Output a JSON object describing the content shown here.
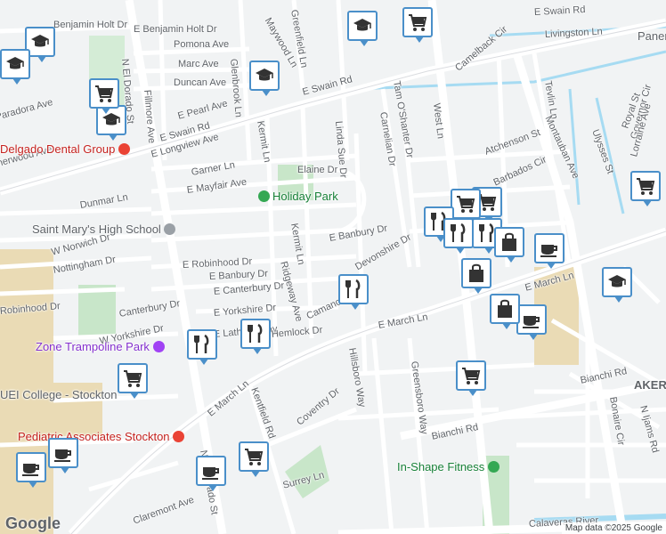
{
  "map": {
    "attribution": "Map data ©2025 Google",
    "logo": "Google",
    "colors": {
      "background": "#f1f3f4",
      "road": "#ffffff",
      "park": "#c8e6c9",
      "campus": "#eadbb5",
      "water": "#a6dbf2",
      "pin_border": "#4a8fc9",
      "pin_icon": "#333333"
    },
    "street_labels": [
      "E Swain Rd",
      "Benjamin Holt Dr",
      "E Benjamin Holt Dr",
      "Pomona Ave",
      "Marc Ave",
      "Duncan Ave",
      "Maywood Ln",
      "Greenfield Ln",
      "Glenbrook Ln",
      "E Swain Rd",
      "E Pearl Ave",
      "E Swain Rd",
      "E Longview Ave",
      "Garner Ln",
      "E Mayfair Ave",
      "Elaine Dr",
      "Linda Sue Dr",
      "Kermit Ln",
      "Fillmore Ave",
      "N El Dorado St",
      "Dunmar Ln",
      "W Norwich Dr",
      "Nottingham Dr",
      "E Robinhood Dr",
      "E Banbury Dr",
      "E Banbury Dr",
      "E Canterbury Dr",
      "Canterbury Dr",
      "Ridgeway Ave",
      "Kermit Ln",
      "E Yorkshire Dr",
      "W Yorkshire Dr",
      "Camanche Ln",
      "Devonshire Dr",
      "E March Ln",
      "E March Ln",
      "E March Ln",
      "Hillsboro Way",
      "Greensboro Way",
      "Coventry Dr",
      "Surrey Ln",
      "Bianchi Rd",
      "Bianchi Rd",
      "N El Dorado St",
      "Claremont Ave",
      "West Ln",
      "Tam O'Shanter Dr",
      "Carnelian Dr",
      "Camelback Cir",
      "Livingston Ln",
      "Tevlin Ln",
      "Montauban Ave",
      "Ulysses St",
      "Royal St",
      "Governor Cir",
      "Lorraine Ave",
      "Atchenson St",
      "Barbados Cir",
      "Bonaire Cir",
      "N Ijams Rd",
      "Calaveras River",
      "Kentfield Rd",
      "Sherwood Ave",
      "Robinhood Dr",
      "Paradora Ave",
      "E Latham Way",
      "Hemlock Dr"
    ],
    "places": [
      "Holiday Park",
      "Saint Mary's High School",
      "Delgado Dental Group",
      "Zone Trampoline Park",
      "UEI College - Stockton",
      "Pediatric Associates Stockton",
      "In-Shape Fitness",
      "Panera",
      "AKER"
    ],
    "markers": [
      "school-marker",
      "school-marker",
      "school-marker",
      "school-marker",
      "school-marker",
      "school-marker",
      "shopping-cart-marker",
      "shopping-cart-marker",
      "shopping-cart-marker",
      "shopping-cart-marker",
      "shopping-cart-marker",
      "shopping-cart-marker",
      "shopping-cart-marker",
      "shopping-cart-marker",
      "restaurant-marker",
      "restaurant-marker",
      "restaurant-marker",
      "restaurant-marker",
      "restaurant-marker",
      "restaurant-marker",
      "cafe-marker",
      "cafe-marker",
      "cafe-marker",
      "cafe-marker",
      "cafe-marker",
      "shopping-bag-marker",
      "shopping-bag-marker",
      "shopping-bag-marker"
    ]
  }
}
